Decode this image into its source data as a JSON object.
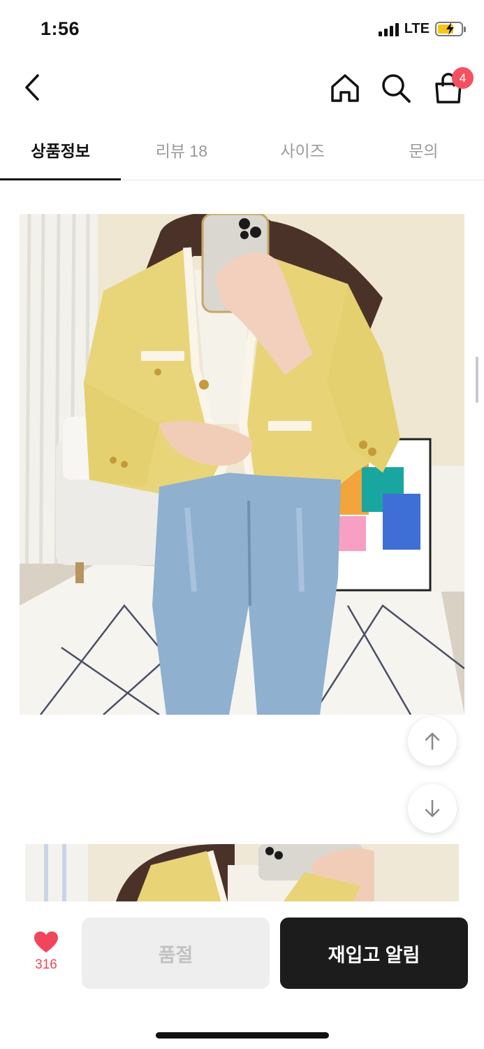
{
  "status_bar": {
    "time": "1:56",
    "network": "LTE",
    "battery_color": "#f5c518"
  },
  "nav": {
    "back_icon": "chevron-left-icon",
    "home_icon": "home-icon",
    "search_icon": "search-icon",
    "cart_icon": "shopping-bag-icon",
    "cart_count": "4",
    "badge_color": "#f2525f"
  },
  "tabs": [
    {
      "label": "상품정보",
      "active": true
    },
    {
      "label": "리뷰 18",
      "active": false
    },
    {
      "label": "사이즈",
      "active": false
    },
    {
      "label": "문의",
      "active": false
    }
  ],
  "scroll_buttons": {
    "up_icon": "arrow-up-icon",
    "down_icon": "arrow-down-icon"
  },
  "bottom_bar": {
    "like_icon": "heart-icon",
    "like_count": "316",
    "like_color": "#f0455a",
    "soldout_label": "품절",
    "restock_label": "재입고 알림"
  }
}
